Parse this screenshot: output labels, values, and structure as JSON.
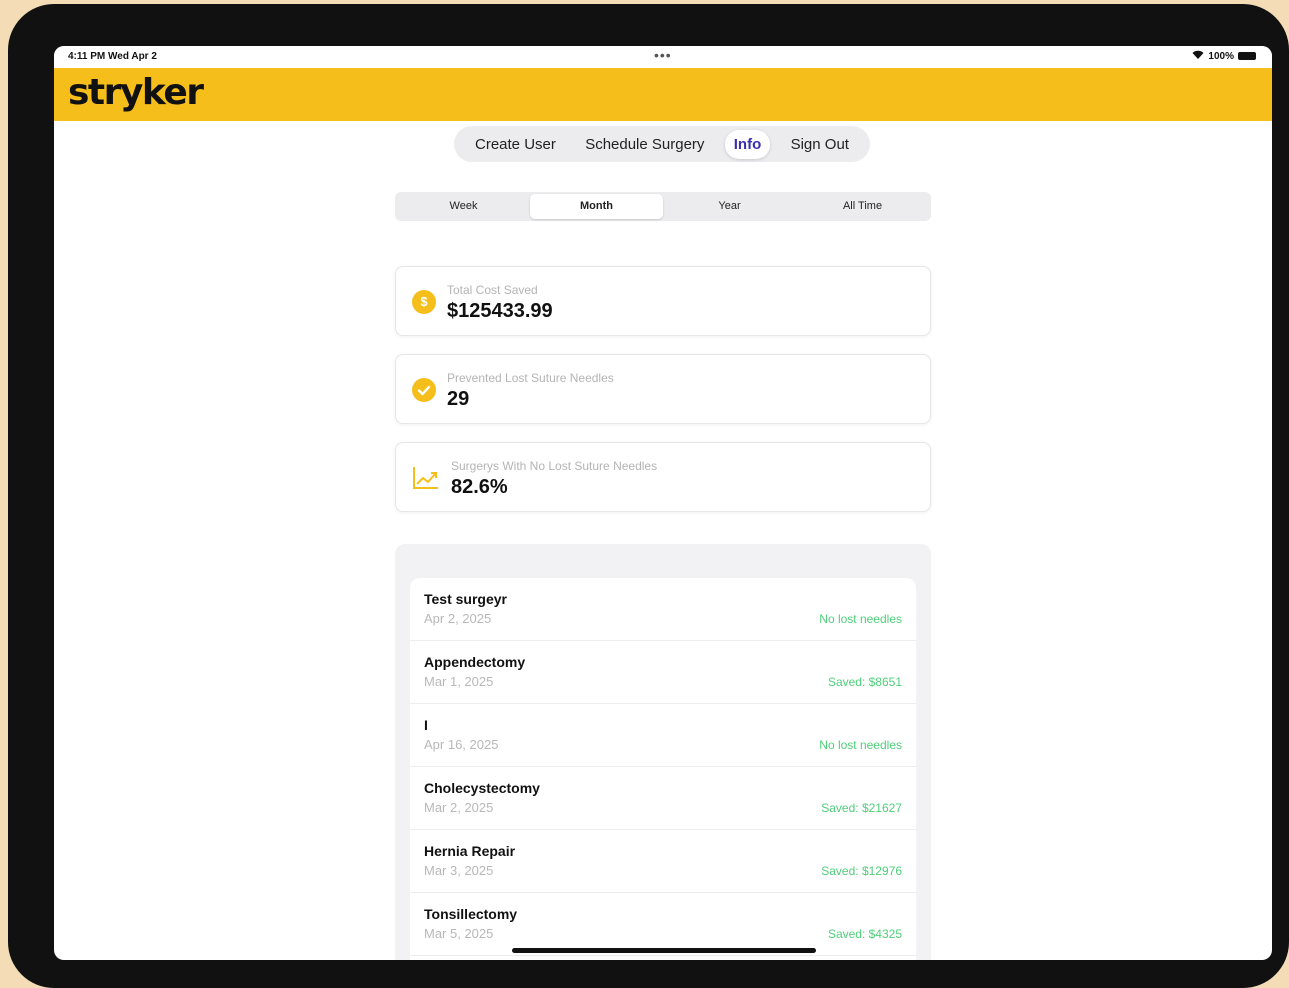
{
  "status_bar": {
    "time": "4:11 PM  Wed Apr 2",
    "dots": "•••",
    "wifi_icon": "wifi-icon",
    "battery": "100%"
  },
  "header": {
    "logo": "stryker",
    "color": "#f6be1a"
  },
  "nav": [
    {
      "label": "Create User",
      "active": false
    },
    {
      "label": "Schedule Surgery",
      "active": false
    },
    {
      "label": "Info",
      "active": true
    },
    {
      "label": "Sign Out",
      "active": false
    }
  ],
  "period_tabs": [
    {
      "label": "Week",
      "active": false
    },
    {
      "label": "Month",
      "active": true
    },
    {
      "label": "Year",
      "active": false
    },
    {
      "label": "All Time",
      "active": false
    }
  ],
  "stats": [
    {
      "icon": "dollar-coin-icon",
      "label": "Total Cost Saved",
      "value": "$125433.99"
    },
    {
      "icon": "checkmark-circle-icon",
      "label": "Prevented Lost Suture Needles",
      "value": "29"
    },
    {
      "icon": "chart-trend-icon",
      "label": "Surgerys With No Lost Suture Needles",
      "value": "82.6%"
    }
  ],
  "surgeries": [
    {
      "name": "Test surgeyr",
      "date": "Apr 2, 2025",
      "status": "No lost needles"
    },
    {
      "name": "Appendectomy",
      "date": "Mar 1, 2025",
      "status": "Saved: $8651"
    },
    {
      "name": "I",
      "date": "Apr 16, 2025",
      "status": "No lost needles"
    },
    {
      "name": "Cholecystectomy",
      "date": "Mar 2, 2025",
      "status": "Saved: $21627"
    },
    {
      "name": "Hernia Repair",
      "date": "Mar 3, 2025",
      "status": "Saved: $12976"
    },
    {
      "name": "Tonsillectomy",
      "date": "Mar 5, 2025",
      "status": "Saved: $4325"
    }
  ]
}
